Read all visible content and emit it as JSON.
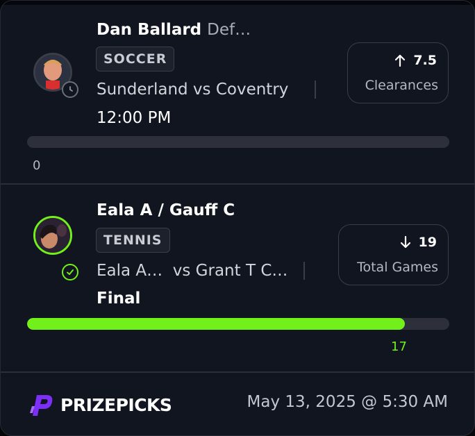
{
  "picks": [
    {
      "player": "Dan Ballard",
      "position": "Def…",
      "sport": "SOCCER",
      "match": "Sunderland vs Coventry",
      "status": "12:00 PM",
      "direction_icon": "arrow-up-icon",
      "line_value": "7.5",
      "stat": "Clearances",
      "progress_value": "0",
      "progress_fraction": 0,
      "state_icon": "clock-icon"
    },
    {
      "player": "Eala A / Gauff C",
      "sport": "TENNIS",
      "match_left": "Eala A…",
      "match_right": "vs Grant T C…",
      "status": "Final",
      "direction_icon": "arrow-down-icon",
      "line_value": "19",
      "stat": "Total Games",
      "progress_value": "17",
      "progress_fraction": 0.895,
      "state_icon": "check-circle-icon",
      "accent_color": "#72f01a"
    }
  ],
  "footer": {
    "brand": "PRIZEPICKS",
    "brand_color": "#7b2ff7",
    "date": "May 13, 2025 @ 5:30 AM"
  }
}
